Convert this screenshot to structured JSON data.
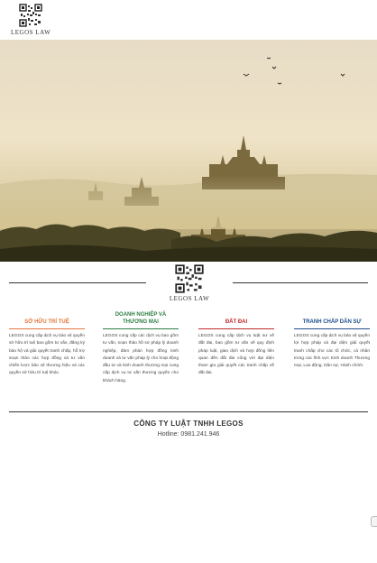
{
  "header": {
    "brand": "LEGOS LAW"
  },
  "divider": {
    "brand": "LEGOS LAW"
  },
  "services": [
    {
      "title": "SỞ HỮU TRÍ TUỆ",
      "color": "#e2763b",
      "desc": "LEGOS cung cấp dịch vụ bảo vệ quyền sở hữu trí tuệ bao gồm tư vấn, đăng ký bảo hộ và giải quyết tranh chấp, hỗ trợ soạn thảo các hợp đồng và tư vấn chiến lược bảo vệ thương hiệu và các quyền sở hữu trí tuệ khác."
    },
    {
      "title": "DOANH NGHIỆP VÀ THƯƠNG MẠI",
      "color": "#2f7d45",
      "desc": "LEGOS cung cấp các dịch vụ bao gồm tư vấn, soạn thảo hồ sơ pháp lý doanh nghiệp, đàm phán hợp đồng kinh doanh và tư vấn pháp lý cho hoạt động đầu tư và kinh doanh thương mại cung cấp dịch vụ tư vấn thương quyền cho khách hàng."
    },
    {
      "title": "ĐẤT ĐAI",
      "color": "#c0282b",
      "desc": "LEGOS cung cấp dịch vụ luật sư về đất đai, bao gồm tư vấn về quy định pháp luật, giao dịch và hợp đồng liên quan đến đất đai cũng với đại diện tham gia giải quyết các tranh chấp về đất đai."
    },
    {
      "title": "TRANH CHẤP DÂN SỰ",
      "color": "#1f4f8c",
      "desc": "LEGOS cung cấp dịch vụ bảo vệ quyền lợi hợp pháp và đại diện giải quyết tranh chấp cho các tổ chức, cá nhân trong các lĩnh vực Kinh doanh Thương mại, Lao động, Dân sự, Hành chính."
    }
  ],
  "footer": {
    "company": "CÔNG TY LUẬT TNHH LEGOS",
    "hotline": "Hotline: 0981.241.946"
  }
}
